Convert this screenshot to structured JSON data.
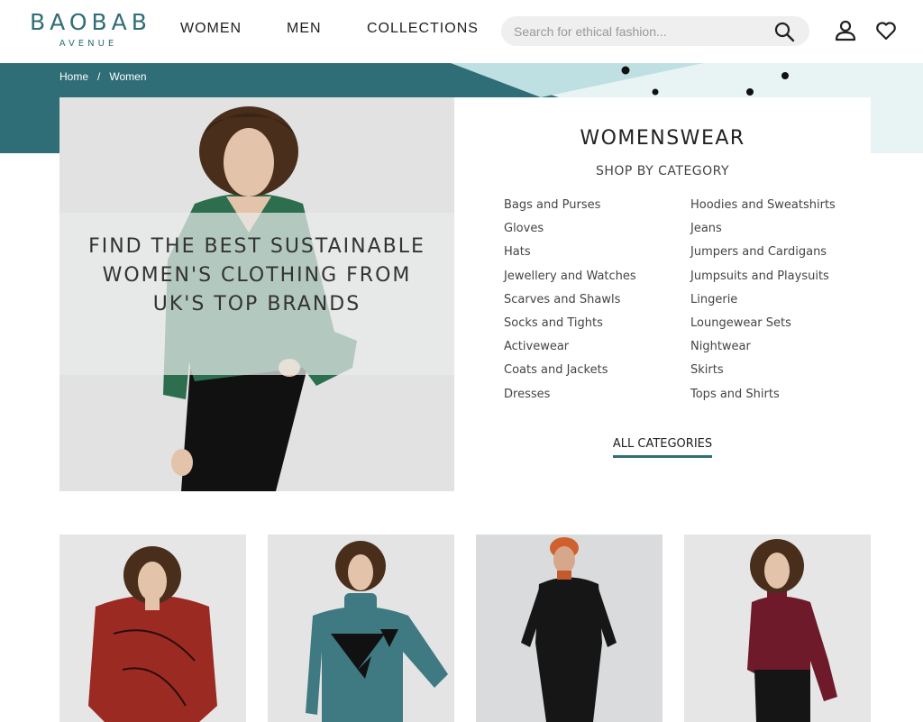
{
  "header": {
    "logo_main": "BAOBAB",
    "logo_sub": "AVENUE",
    "nav": [
      "WOMEN",
      "MEN",
      "COLLECTIONS"
    ],
    "search_placeholder": "Search for ethical fashion..."
  },
  "breadcrumb": {
    "home": "Home",
    "separator": "/",
    "current": "Women"
  },
  "hero": {
    "headline": "FIND THE BEST SUSTAINABLE WOMEN'S CLOTHING FROM UK'S TOP BRANDS"
  },
  "category_panel": {
    "title": "WOMENSWEAR",
    "subtitle": "SHOP BY CATEGORY",
    "left": [
      "Bags and Purses",
      "Gloves",
      "Hats",
      "Jewellery and Watches",
      "Scarves and Shawls",
      "Socks and Tights",
      "Activewear",
      "Coats and Jackets",
      "Dresses"
    ],
    "right": [
      "Hoodies and Sweatshirts",
      "Jeans",
      "Jumpers and Cardigans",
      "Jumpsuits and Playsuits",
      "Lingerie",
      "Loungewear Sets",
      "Nightwear",
      "Skirts",
      "Tops and Shirts"
    ],
    "all_label": "ALL CATEGORIES"
  },
  "colors": {
    "brand": "#2f6e77",
    "banner_light": "#bfe0e3"
  },
  "icons": [
    "search-icon",
    "user-icon",
    "heart-icon"
  ]
}
